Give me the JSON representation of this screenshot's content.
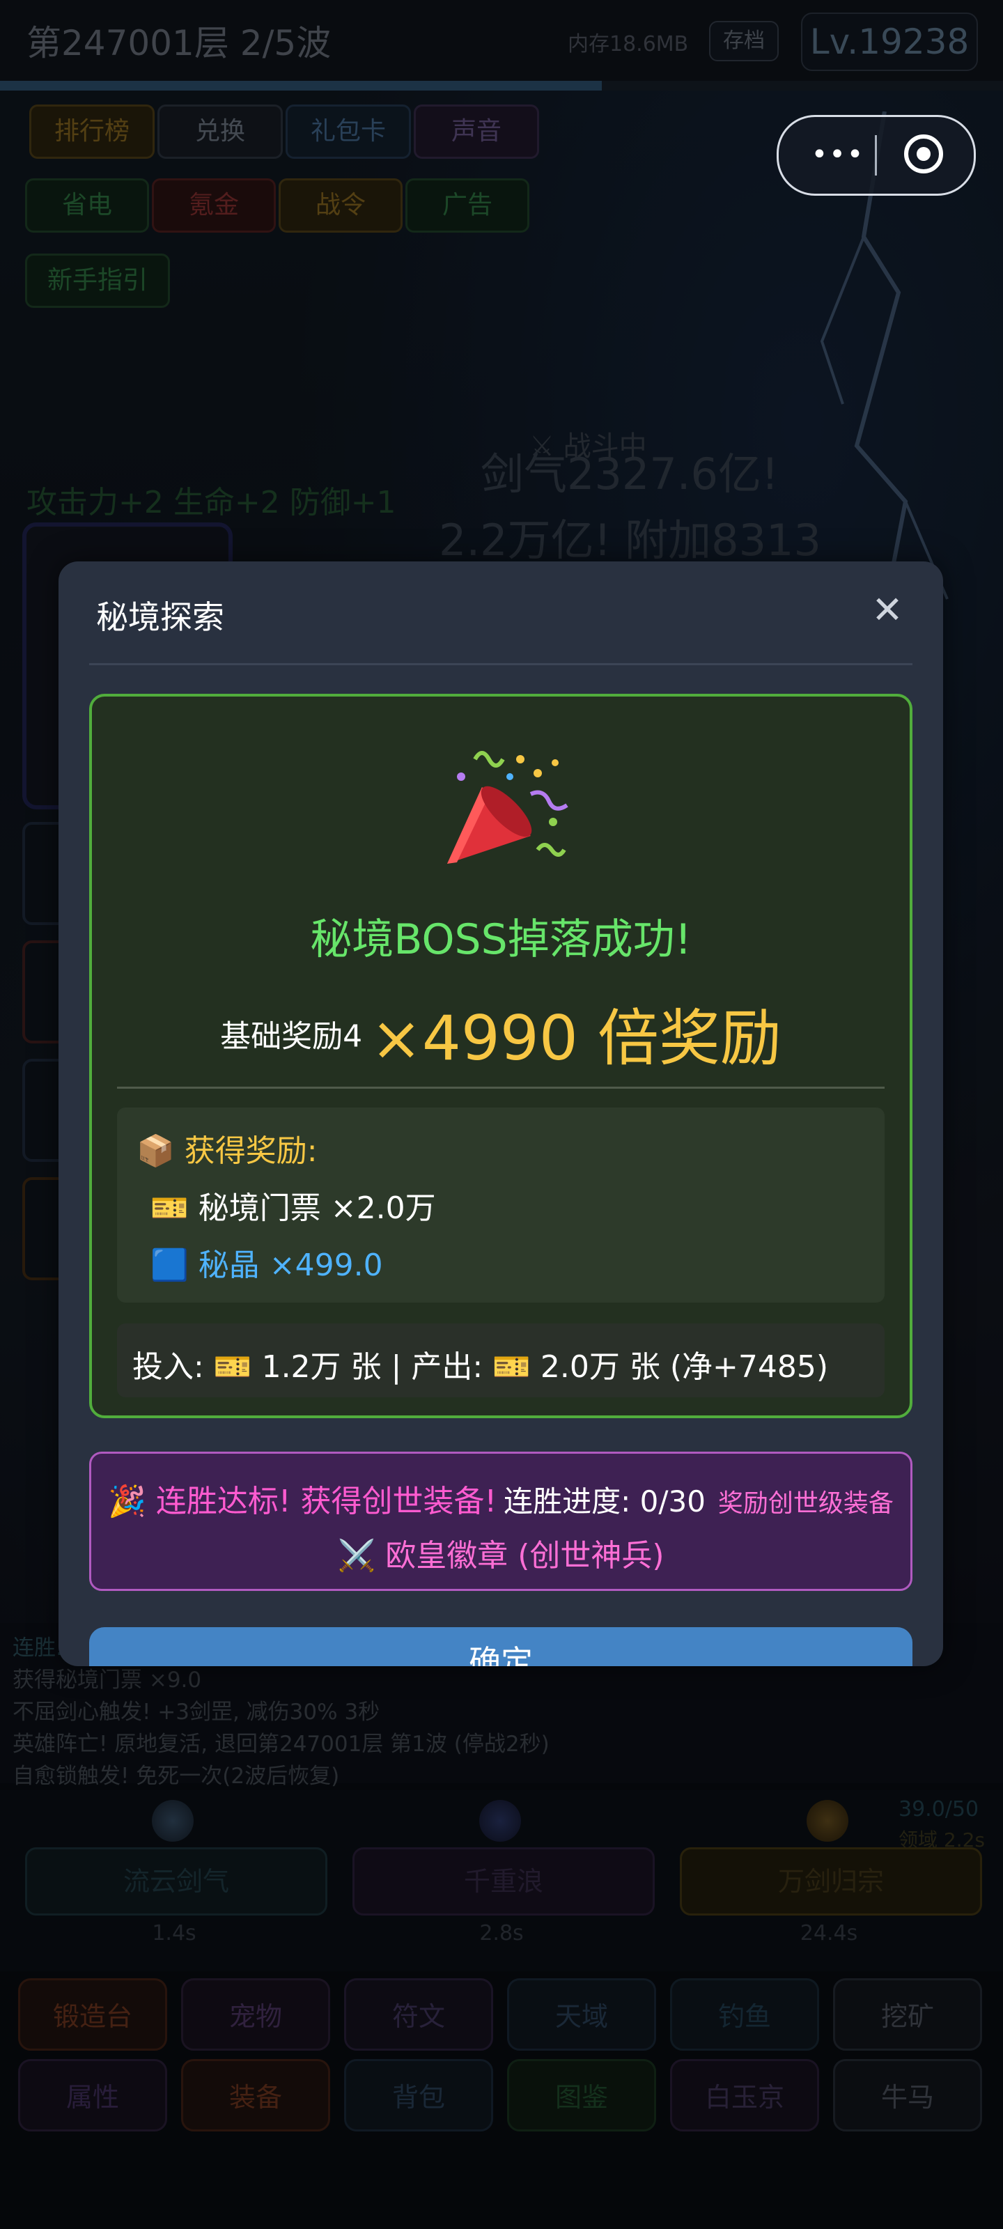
{
  "header": {
    "level_wave": "第247001层  2/5波",
    "memory": "内存18.6MB",
    "save_label": "存档",
    "player_level": "Lv.19238",
    "progress": 0.6
  },
  "menu_chips": {
    "row1": [
      "排行榜",
      "兑换",
      "礼包卡",
      "声音"
    ],
    "row2": [
      "省电",
      "氪金",
      "战令",
      "广告"
    ],
    "row3": [
      "新手指引"
    ]
  },
  "battle": {
    "status": "⚔ 战斗中",
    "sword_qi": "剑气2327.6亿!",
    "damage": "2.2万亿! 附加8313",
    "buff": "攻击力+2 生命+2 防御+1"
  },
  "modal": {
    "title": "秘境探索",
    "close_icon": "close-icon",
    "celebration_icon": "party-popper-icon",
    "success_title": "秘境BOSS掉落成功!",
    "base_reward": "基础奖励4",
    "multiplier": "×4990 倍奖励",
    "gain_header": "📦 获得奖励:",
    "gain_items": [
      {
        "icon": "ticket-icon",
        "text": "🎫 秘境门票 ×2.0万",
        "color": "#ffffff"
      },
      {
        "icon": "crystal-icon",
        "text": "🟦 秘晶 ×499.0",
        "color": "#4fb3ff"
      }
    ],
    "io_summary": "投入: 🎫 1.2万 张 | 产出: 🎫 2.0万 张 (净+7485)",
    "streak": {
      "main": "🎉 连胜达标! 获得创世装备!",
      "progress": "连胜进度: 0/30",
      "reward_hint": "奖励创世级装备",
      "item": "⚔️ 欧皇徽章 (创世神兵)"
    },
    "confirm_label": "确定"
  },
  "battle_log": [
    "连胜…",
    "获得秘境门票 ×9.0",
    "不屈剑心触发! +3剑罡, 减伤30% 3秒",
    "英雄阵亡! 原地复活, 退回第247001层 第1波 (停战2秒)",
    "自愈锁触发! 免死一次(2波后恢复)"
  ],
  "skills": [
    {
      "name": "流云剑气",
      "time": "1.4s",
      "icon": "wind-sword-icon"
    },
    {
      "name": "千重浪",
      "time": "2.8s",
      "icon": "wave-icon"
    },
    {
      "name": "万剑归宗",
      "time": "24.4s",
      "icon": "sun-sword-icon"
    }
  ],
  "skill_stats": {
    "count": "39.0/50",
    "extra": "领域 2.2s"
  },
  "tabs": {
    "row1": [
      "锻造台",
      "宠物",
      "符文",
      "天域",
      "钓鱼",
      "挖矿"
    ],
    "row2": [
      "属性",
      "装备",
      "背包",
      "图鉴",
      "白玉京",
      "牛马"
    ]
  },
  "colors": {
    "accent_green": "#67e56a",
    "gold": "#f7c744",
    "magenta": "#ff5bd0",
    "confirm_blue": "#4484c5"
  }
}
